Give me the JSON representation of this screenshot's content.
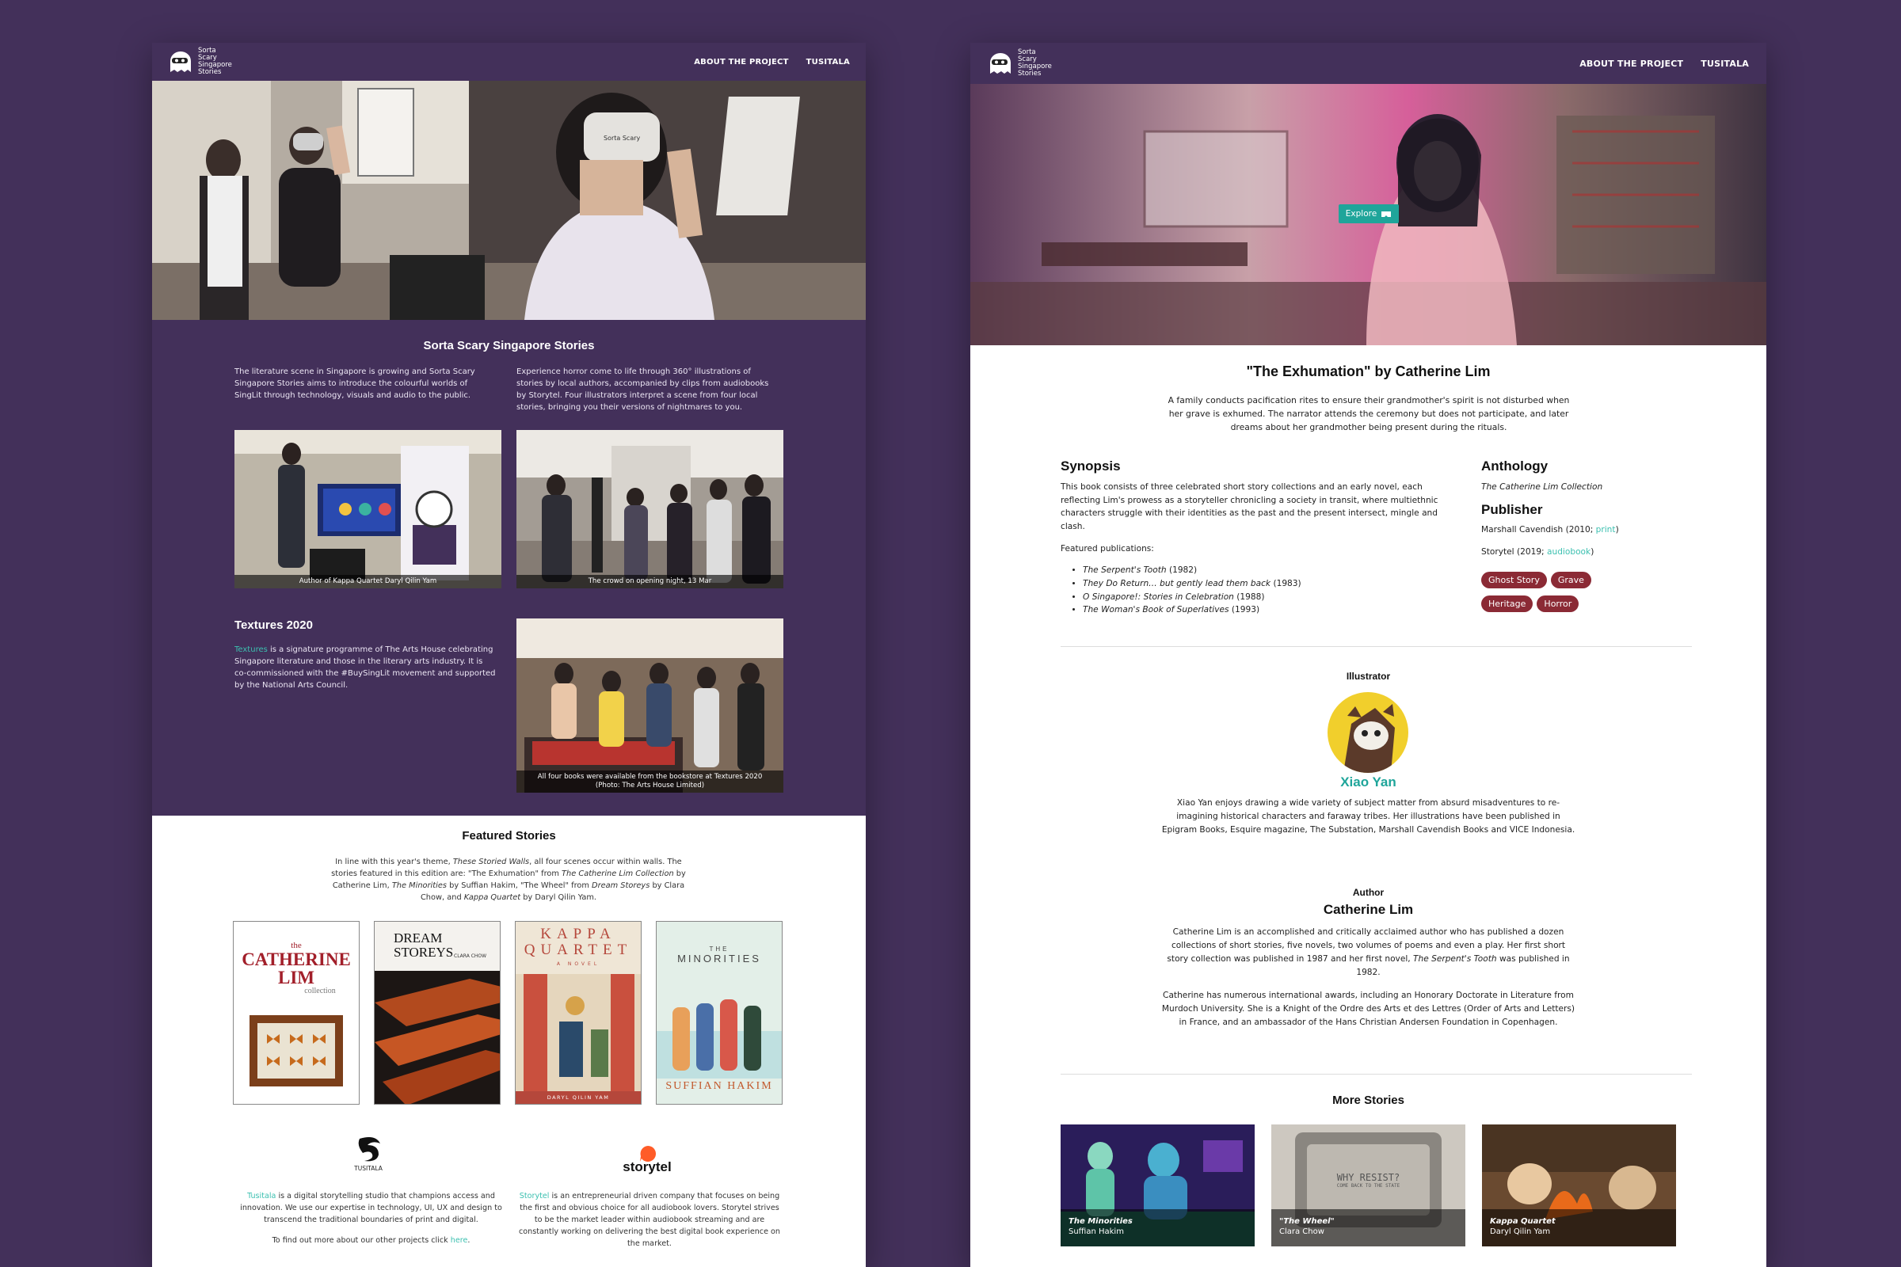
{
  "nav": {
    "logo_lines": [
      "Sorta",
      "Scary",
      "Singapore",
      "Stories"
    ],
    "links": [
      "ABOUT THE PROJECT",
      "TUSITALA"
    ]
  },
  "left_page": {
    "intro_title": "Sorta Scary Singapore Stories",
    "intro_col1": "The literature scene in Singapore is growing and Sorta Scary Singapore Stories aims to introduce the colourful worlds of SingLit through technology, visuals and audio to the public.",
    "intro_col2": "Experience horror come to life through 360° illustrations of stories by local authors, accompanied by clips from audiobooks by Storytel. Four illustrators interpret a scene from four local stories, bringing you their versions of nightmares to you.",
    "photo1_caption": "Author of Kappa Quartet Daryl Qilin Yam",
    "photo2_caption": "The crowd on opening night, 13 Mar",
    "textures_title": "Textures 2020",
    "textures_link": "Textures",
    "textures_body": " is a signature programme of The Arts House celebrating Singapore literature and those in the literary arts industry. It is co-commissioned with the #BuySingLit movement and supported by the National Arts Council.",
    "photo3_caption_line1": "All four books were available from the bookstore at Textures 2020",
    "photo3_caption_line2": "(Photo: The Arts House Limited)",
    "featured_title": "Featured Stories",
    "featured_p1": "In line with this year's theme, ",
    "featured_theme": "These Storied Walls",
    "featured_p2": ", all four scenes occur within walls. The stories featured in this edition are: \"The Exhumation\" from ",
    "featured_b1": "The Catherine Lim Collection",
    "featured_p3": " by Catherine Lim, ",
    "featured_b2": "The Minorities",
    "featured_p4": " by Suffian Hakim, \"The Wheel\" from ",
    "featured_b3": "Dream Storeys",
    "featured_p5": " by Clara Chow, and ",
    "featured_b4": "Kappa Quartet",
    "featured_p6": " by Daryl Qilin Yam.",
    "covers": [
      {
        "l1": "the",
        "l2": "CATHERINE",
        "l3": "LIM",
        "l4": "collection"
      },
      {
        "l1": "DREAM",
        "l2": "STOREYS",
        "l3": "CLARA CHOW"
      },
      {
        "l1": "KAPPA",
        "l2": "QUARTET",
        "l3": "A NOVEL",
        "l4": "DARYL QILIN YAM"
      },
      {
        "l1": "THE",
        "l2": "MINORITIES",
        "l3": "SUFFIAN HAKIM"
      }
    ],
    "partner1_name": "TUSITALA",
    "partner1_link": "Tusitala",
    "partner1_body": " is a digital storytelling studio that champions access and innovation. We use our expertise in technology, UI, UX and design to transcend the traditional boundaries of print and digital.",
    "partner1_more": "To find out more about our other projects click ",
    "partner1_more_link": "here",
    "partner2_name": "storytel",
    "partner2_link": "Storytel",
    "partner2_body": " is an entrepreneurial driven company that focuses on being the first and obvious choice for all audiobook lovers. Storytel strives to be the market leader within audiobook streaming and are constantly working on delivering the best digital book experience on the market."
  },
  "right_page": {
    "explore_label": "Explore",
    "story_title": "\"The Exhumation\" by Catherine Lim",
    "story_summary": "A family conducts pacification rites to ensure their grandmother's spirit is not disturbed when her grave is exhumed. The narrator attends the ceremony but does not participate, and later dreams about her grandmother being present during the rituals.",
    "synopsis_heading": "Synopsis",
    "synopsis_body": "This book consists of three celebrated short story collections and an early novel, each reflecting Lim's prowess as a storyteller chronicling a society in transit, where multiethnic characters struggle with their identities as the past and the present intersect, mingle and clash.",
    "featured_pubs_label": "Featured publications:",
    "publications": [
      {
        "title": "The Serpent's Tooth",
        "year": " (1982)"
      },
      {
        "title": "They Do Return… but gently lead them back",
        "year": " (1983)"
      },
      {
        "title": "O Singapore!: Stories in Celebration",
        "year": " (1988)"
      },
      {
        "title": "The Woman's Book of Superlatives",
        "year": " (1993)"
      }
    ],
    "anthology_heading": "Anthology",
    "anthology_value": "The Catherine Lim Collection",
    "publisher_heading": "Publisher",
    "publisher1_text": "Marshall Cavendish (2010; ",
    "publisher1_link": "print",
    "publisher2_text": "Storytel (2019; ",
    "publisher2_link": "audiobook",
    "tags": [
      "Ghost Story",
      "Grave",
      "Heritage",
      "Horror"
    ],
    "illustrator_label": "Illustrator",
    "illustrator_name": "Xiao Yan",
    "illustrator_bio": "Xiao Yan enjoys drawing a wide variety of subject matter from absurd misadventures to re-imagining historical characters and faraway tribes. Her illustrations have been published in Epigram Books, Esquire magazine, The Substation, Marshall Cavendish Books and VICE Indonesia.",
    "author_label": "Author",
    "author_name": "Catherine Lim",
    "author_bio1_a": "Catherine Lim is an accomplished and critically acclaimed author who has published a dozen collections of short stories, five novels, two volumes of poems and even a play. Her first short story collection was published in 1987 and her first novel, ",
    "author_bio1_b": "The Serpent's Tooth",
    "author_bio1_c": " was published in 1982.",
    "author_bio2": "Catherine has numerous international awards, including an Honorary Doctorate in Literature from Murdoch University. She is a Knight of the Ordre des Arts et des Lettres (Order of Arts and Letters) in France, and an ambassador of the Hans Christian Andersen Foundation in Copenhagen.",
    "more_title": "More Stories",
    "more_stories": [
      {
        "title": "The Minorities",
        "author": "Suffian Hakim"
      },
      {
        "title": "\"The Wheel\"",
        "author": "Clara Chow",
        "overlay_l1": "WHY RESIST?",
        "overlay_l2": "COME BACK TO THE STATE"
      },
      {
        "title": "Kappa Quartet",
        "author": "Daryl Qilin Yam"
      }
    ]
  },
  "colors": {
    "background": "#43305a",
    "accent_teal": "#3cc0b0",
    "tag_red": "#8b2a35"
  }
}
